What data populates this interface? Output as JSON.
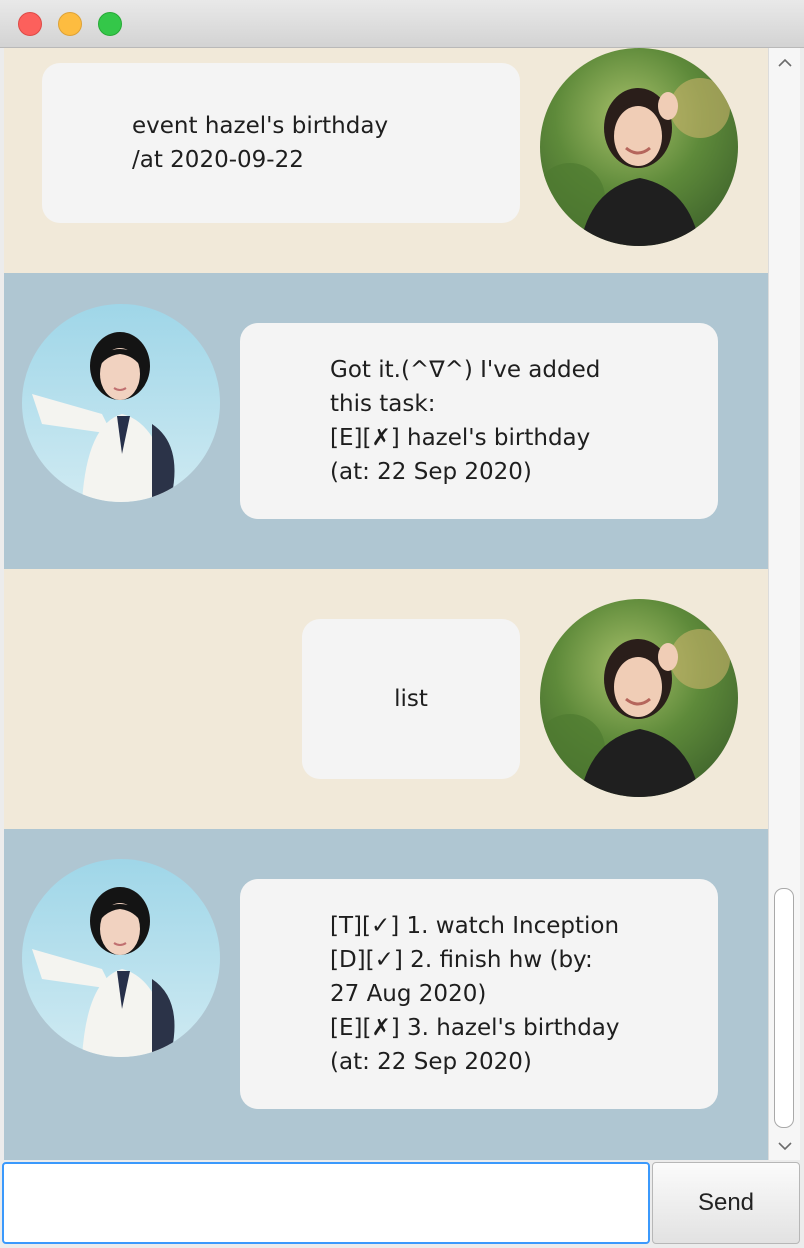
{
  "window": {
    "controls": [
      "close",
      "minimize",
      "maximize"
    ]
  },
  "messages": [
    {
      "sender": "user",
      "lines": [
        "event hazel's birthday",
        "/at 2020-09-22"
      ]
    },
    {
      "sender": "bot",
      "lines": [
        "Got it.(^∇^) I've added",
        "this task:",
        "[E][✗] hazel's birthday",
        "(at: 22 Sep 2020)"
      ]
    },
    {
      "sender": "user",
      "lines": [
        "list"
      ]
    },
    {
      "sender": "bot",
      "lines": [
        "[T][✓] 1. watch Inception",
        "[D][✓] 2. finish hw (by:",
        "27 Aug 2020)",
        "[E][✗] 3. hazel's birthday",
        "(at: 22 Sep 2020)"
      ]
    }
  ],
  "input": {
    "value": "",
    "placeholder": ""
  },
  "send_button": {
    "label": "Send"
  },
  "colors": {
    "user_row_bg": "#f1e9d9",
    "bot_row_bg": "#afc6d2",
    "bubble_bg": "#f4f4f4",
    "input_focus_border": "#3b99fc"
  },
  "icons": {
    "user_avatar": "user-avatar-photo",
    "bot_avatar": "bot-avatar-photo",
    "scroll_up": "chevron-up-icon",
    "scroll_down": "chevron-down-icon"
  }
}
